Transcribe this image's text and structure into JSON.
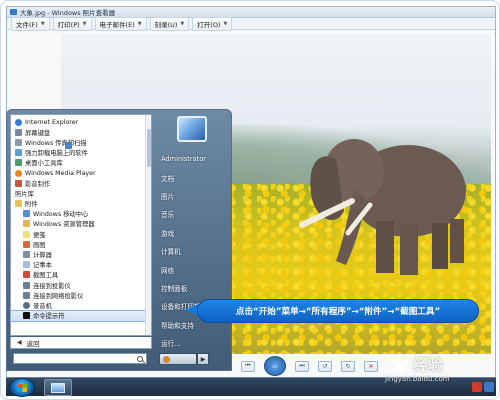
{
  "window": {
    "title": "大象.jpg - Windows 照片查看器"
  },
  "menubar": {
    "items": [
      {
        "label": "文件(F)"
      },
      {
        "label": "打印(P)"
      },
      {
        "label": "电子邮件(E)"
      },
      {
        "label": "刻录(U)"
      },
      {
        "label": "打开(O)"
      }
    ]
  },
  "start_menu": {
    "programs": [
      {
        "label": "Internet Explorer",
        "icon": "ie-icon"
      },
      {
        "label": "屏幕键盘",
        "icon": "keyboard-icon"
      },
      {
        "label": "Windows 传真和扫描",
        "icon": "fax-icon"
      },
      {
        "label": "强力卸载电脑上的软件",
        "icon": "uninstall-icon"
      },
      {
        "label": "桌面小工具库",
        "icon": "gadget-icon"
      },
      {
        "label": "Windows Media Player",
        "icon": "media-player-icon"
      },
      {
        "label": "影音制作",
        "icon": "movie-maker-icon"
      },
      {
        "label": "照片库",
        "icon": "photo-gallery-icon"
      },
      {
        "label": "附件",
        "icon": "folder-icon"
      },
      {
        "label": "Windows 移动中心",
        "icon": "mobility-center-icon"
      },
      {
        "label": "Windows 资源管理器",
        "icon": "explorer-icon"
      },
      {
        "label": "便笺",
        "icon": "sticky-notes-icon"
      },
      {
        "label": "画图",
        "icon": "paint-icon"
      },
      {
        "label": "计算器",
        "icon": "calculator-icon"
      },
      {
        "label": "记事本",
        "icon": "notepad-icon"
      },
      {
        "label": "截图工具",
        "icon": "snipping-tool-icon"
      },
      {
        "label": "连接到投影仪",
        "icon": "projector-icon"
      },
      {
        "label": "连接到网络投影仪",
        "icon": "network-projector-icon"
      },
      {
        "label": "录音机",
        "icon": "sound-recorder-icon"
      },
      {
        "label": "命令提示符",
        "icon": "command-prompt-icon"
      }
    ],
    "back_label": "返回",
    "search_placeholder": "",
    "right_items": [
      {
        "label": "Administrator"
      },
      {
        "label": "文档"
      },
      {
        "label": "图片"
      },
      {
        "label": "音乐"
      },
      {
        "label": "游戏"
      },
      {
        "label": "计算机"
      },
      {
        "label": "网络"
      },
      {
        "label": "控制面板"
      },
      {
        "label": "设备和打印机"
      },
      {
        "label": "帮助和支持"
      },
      {
        "label": "运行..."
      }
    ]
  },
  "callout": {
    "text": "点击“开始”菜单→“所有程序”→“附件”→“截图工具”"
  },
  "viewer_controls": {
    "prev": "⏮",
    "play": "▭",
    "next": "⏭",
    "rotate_ccw": "↺",
    "rotate_cw": "↻",
    "delete": "✕"
  },
  "watermark": {
    "brand": "经验",
    "url": "jingyan.baidu.com"
  },
  "colors": {
    "callout_bg": "#1578d9",
    "taskbar_bg": "#233548",
    "start_menu_bg": "#5a7691"
  }
}
